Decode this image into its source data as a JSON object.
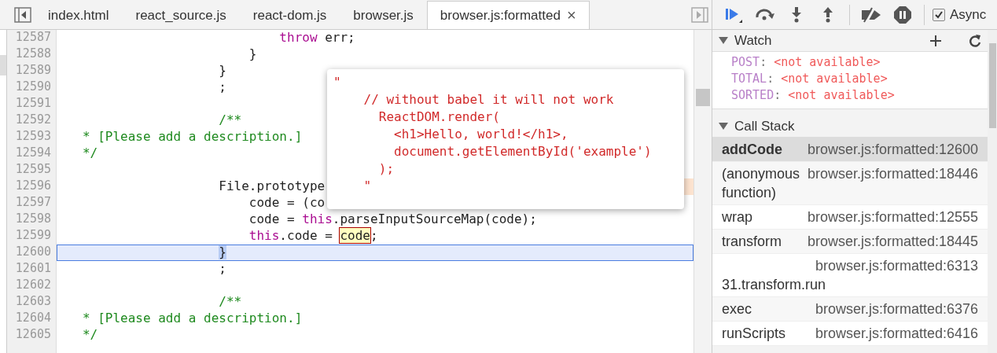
{
  "editor": {
    "tabs": [
      {
        "label": "index.html",
        "selected": false,
        "closable": false
      },
      {
        "label": "react_source.js",
        "selected": false,
        "closable": false
      },
      {
        "label": "react-dom.js",
        "selected": false,
        "closable": false
      },
      {
        "label": "browser.js",
        "selected": false,
        "closable": false
      },
      {
        "label": "browser.js:formatted",
        "selected": true,
        "closable": true,
        "close": "×"
      }
    ],
    "lines": [
      {
        "number": "12587",
        "selected": false,
        "flagged": false,
        "tokens": [
          {
            "kind": "keyword",
            "text": "                             throw"
          },
          {
            "kind": "plain",
            "text": " err;"
          }
        ]
      },
      {
        "number": "12588",
        "selected": false,
        "flagged": false,
        "tokens": [
          {
            "kind": "plain",
            "text": "                         }"
          }
        ]
      },
      {
        "number": "12589",
        "selected": false,
        "flagged": false,
        "tokens": [
          {
            "kind": "plain",
            "text": "                     }"
          }
        ]
      },
      {
        "number": "12590",
        "selected": false,
        "flagged": false,
        "tokens": [
          {
            "kind": "plain",
            "text": "                     ;"
          }
        ]
      },
      {
        "number": "12591",
        "selected": false,
        "flagged": false
      },
      {
        "number": "12592",
        "selected": false,
        "flagged": false,
        "tokens": [
          {
            "kind": "comment",
            "text": "                     /**"
          }
        ]
      },
      {
        "number": "12593",
        "selected": false,
        "flagged": false,
        "tokens": [
          {
            "kind": "comment",
            "text": "   * [Please add a description.]"
          }
        ]
      },
      {
        "number": "12594",
        "selected": false,
        "flagged": false,
        "tokens": [
          {
            "kind": "comment",
            "text": "   */"
          }
        ]
      },
      {
        "number": "12595",
        "selected": false,
        "flagged": false
      },
      {
        "number": "12596",
        "selected": false,
        "flagged": true,
        "tokens": [
          {
            "kind": "plain",
            "text": "                     File.prototype"
          }
        ]
      },
      {
        "number": "12597",
        "selected": false,
        "flagged": false,
        "tokens": [
          {
            "kind": "plain",
            "text": "                         code = (co"
          }
        ]
      },
      {
        "number": "12598",
        "selected": false,
        "flagged": false,
        "tokens": [
          {
            "kind": "plain",
            "text": "                         code = "
          },
          {
            "kind": "keyword",
            "text": "this"
          },
          {
            "kind": "plain",
            "text": ".parseInputSourceMap(code);"
          }
        ]
      },
      {
        "number": "12599",
        "selected": false,
        "flagged": false,
        "tokens": [
          {
            "kind": "keyword",
            "text": "                         this"
          },
          {
            "kind": "plain",
            "text": ".code = "
          },
          {
            "kind": "hover",
            "text": "code"
          },
          {
            "kind": "plain",
            "text": ";"
          }
        ]
      },
      {
        "number": "12600",
        "selected": true,
        "flagged": false,
        "tokens": [
          {
            "kind": "match",
            "text": "                     }"
          }
        ]
      },
      {
        "number": "12601",
        "selected": false,
        "flagged": false,
        "tokens": [
          {
            "kind": "plain",
            "text": "                     ;"
          }
        ]
      },
      {
        "number": "12602",
        "selected": false,
        "flagged": false
      },
      {
        "number": "12603",
        "selected": false,
        "flagged": false,
        "tokens": [
          {
            "kind": "comment",
            "text": "                     /**"
          }
        ]
      },
      {
        "number": "12604",
        "selected": false,
        "flagged": false,
        "tokens": [
          {
            "kind": "comment",
            "text": "   * [Please add a description.]"
          }
        ]
      },
      {
        "number": "12605",
        "selected": false,
        "flagged": false,
        "tokens": [
          {
            "kind": "comment",
            "text": "   */"
          }
        ]
      }
    ],
    "popover": {
      "lines": [
        "\"",
        "    // without babel it will not work",
        "      ReactDOM.render(",
        "        <h1>Hello, world!</h1>,",
        "        document.getElementById('example')",
        "      );",
        "    \""
      ]
    }
  },
  "debugger": {
    "async": {
      "label": "Async",
      "checked": true
    },
    "watch": {
      "title": "Watch",
      "expanded": true,
      "items": [
        {
          "name": "POST",
          "separator": ":",
          "value": "<not available>"
        },
        {
          "name": "TOTAL",
          "separator": ":",
          "value": "<not available>"
        },
        {
          "name": "SORTED",
          "separator": ":",
          "value": "<not available>"
        }
      ]
    },
    "call_stack": {
      "title": "Call Stack",
      "expanded": true,
      "frames": [
        {
          "name": "addCode",
          "location": "browser.js:formatted:12600",
          "selected": true
        },
        {
          "name": "(anonymous function)",
          "location": "browser.js:formatted:18446",
          "selected": false
        },
        {
          "name": "wrap",
          "location": "browser.js:formatted:12555",
          "selected": false
        },
        {
          "name": "transform",
          "location": "browser.js:formatted:18445",
          "selected": false
        },
        {
          "name": "31.transform.run",
          "location": "browser.js:formatted:6313",
          "selected": false
        },
        {
          "name": "exec",
          "location": "browser.js:formatted:6376",
          "selected": false
        },
        {
          "name": "runScripts",
          "location": "browser.js:formatted:6416",
          "selected": false
        }
      ]
    }
  }
}
